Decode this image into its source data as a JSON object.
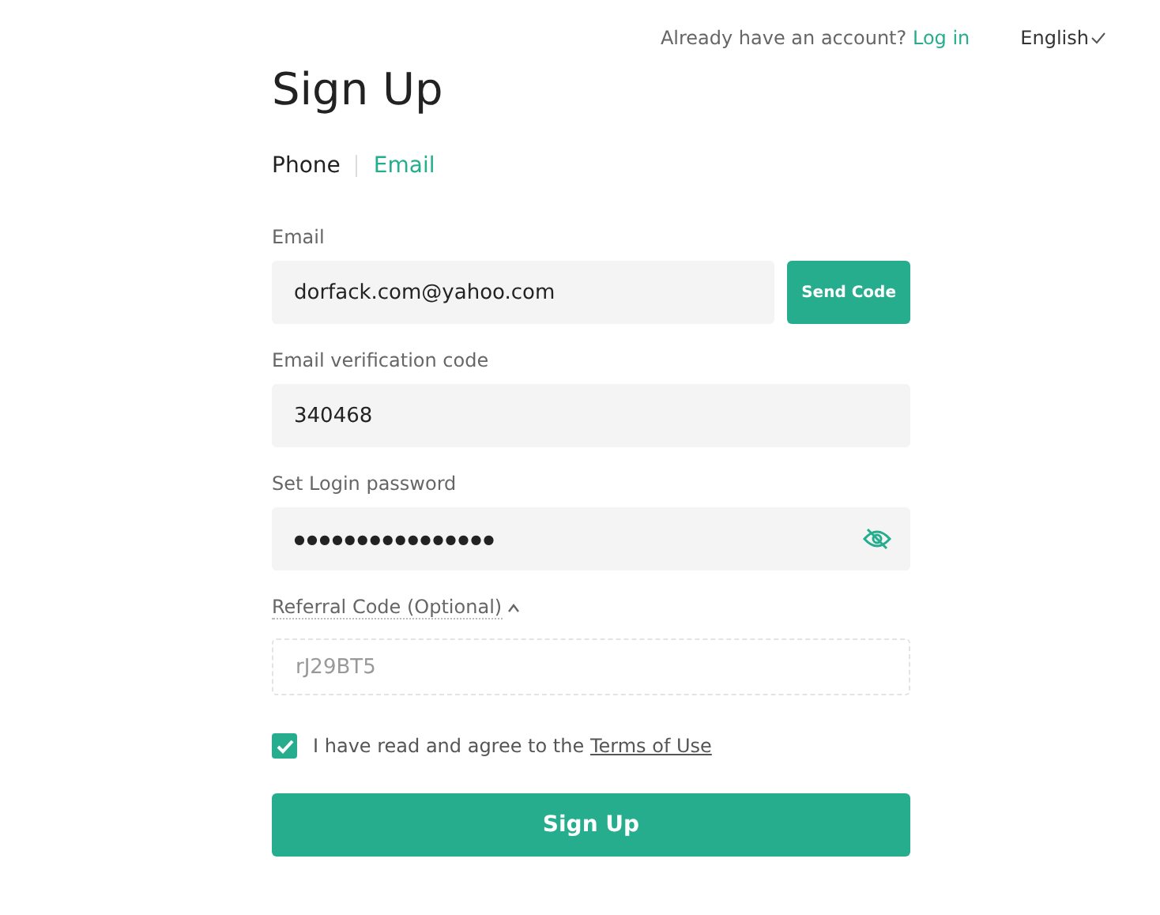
{
  "header": {
    "prompt": "Already have an account?",
    "login_link": "Log in",
    "language": "English"
  },
  "title": "Sign Up",
  "tabs": [
    {
      "label": "Phone",
      "selected": false
    },
    {
      "label": "Email",
      "selected": true
    }
  ],
  "fields": [
    {
      "kind": "text",
      "label": "Email",
      "value": "dorfack.com@yahoo.com",
      "button": "Send Code"
    },
    {
      "kind": "text",
      "label": "Email verification code",
      "value": "340468"
    },
    {
      "kind": "password",
      "label": "Set Login password",
      "value": "●●●●●●●●●●●●●●●●"
    }
  ],
  "referral": {
    "label": "Referral Code (Optional)",
    "expanded": true,
    "placeholder": "rJ29BT5"
  },
  "agreement": {
    "checked": true,
    "text": "I have read and agree to the",
    "link": "Terms of Use"
  },
  "submit": "Sign Up"
}
